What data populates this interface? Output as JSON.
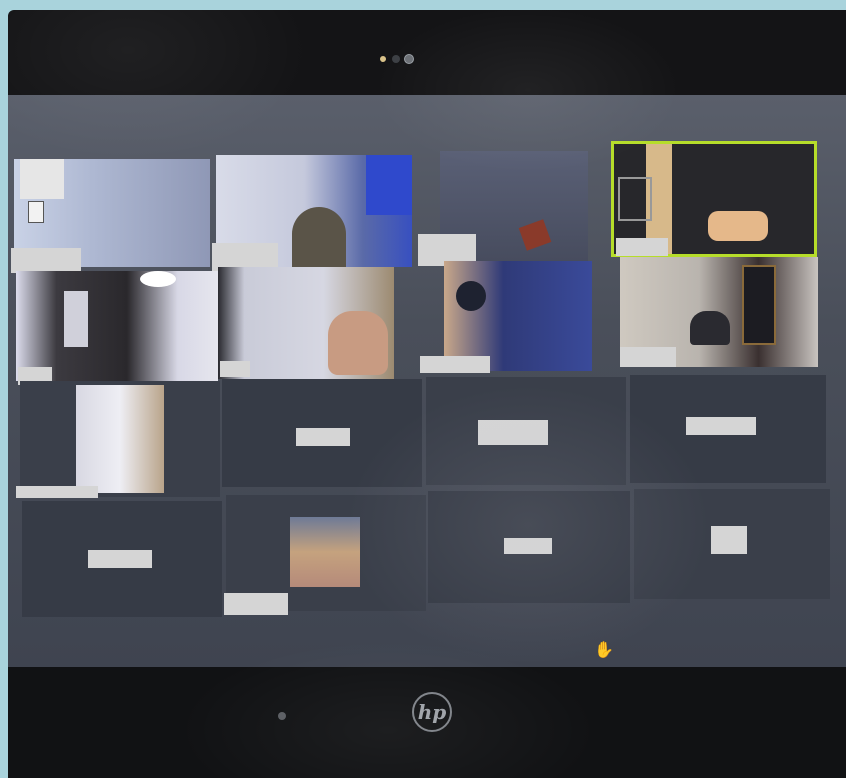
{
  "device": {
    "type": "laptop",
    "brand_logo": "hp"
  },
  "meeting": {
    "layout": "gallery-4x4",
    "active_speaker_color": "#b6dd2a",
    "participant_names_redacted": true,
    "tiles": [
      {
        "slot": 1,
        "video": "on"
      },
      {
        "slot": 2,
        "video": "on"
      },
      {
        "slot": 3,
        "video": "on"
      },
      {
        "slot": 4,
        "video": "on",
        "active_speaker": true
      },
      {
        "slot": 5,
        "video": "on"
      },
      {
        "slot": 6,
        "video": "on"
      },
      {
        "slot": 7,
        "video": "on"
      },
      {
        "slot": 8,
        "video": "on"
      },
      {
        "slot": 9,
        "video": "on"
      },
      {
        "slot": 10,
        "video": "off"
      },
      {
        "slot": 11,
        "video": "off"
      },
      {
        "slot": 12,
        "video": "off"
      },
      {
        "slot": 13,
        "video": "off"
      },
      {
        "slot": 14,
        "video": "off",
        "avatar": "profile-picture"
      },
      {
        "slot": 15,
        "video": "off",
        "raised_hand": true
      },
      {
        "slot": 16,
        "video": "off"
      }
    ]
  },
  "icons": {
    "raised_hand": "raised-hand-icon",
    "muted_mic": "muted-mic-icon",
    "camera": "webcam-icon"
  }
}
